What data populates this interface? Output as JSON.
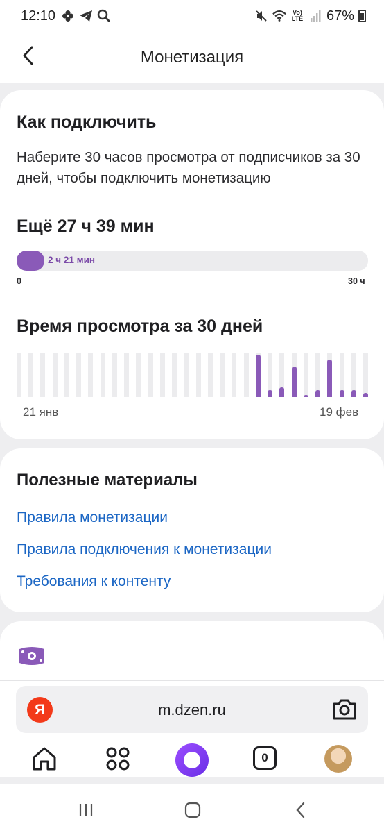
{
  "status_bar": {
    "time": "12:10",
    "battery_percent": "67%",
    "lte_label": "Vo) LTE"
  },
  "header": {
    "title": "Монетизация",
    "back_icon": "chevron-left-icon"
  },
  "how_to": {
    "title": "Как подключить",
    "description": "Наберите 30 часов просмотра от подписчиков за 30 дней, чтобы подключить монетизацию",
    "remaining": "Ещё 27 ч 39 мин",
    "progress_label": "2 ч 21 мин",
    "progress_fraction": 0.078,
    "axis_min": "0",
    "axis_max": "30 ч"
  },
  "watch_time": {
    "title": "Время просмотра за 30 дней",
    "start_label": "21 янв",
    "end_label": "19 фев",
    "accent_color": "#8a5ab8"
  },
  "chart_data": {
    "type": "bar",
    "values": [
      0,
      0,
      0,
      0,
      0,
      0,
      0,
      0,
      0,
      0,
      0,
      0,
      0,
      0,
      0,
      0,
      0,
      0,
      0,
      0,
      0.95,
      0.15,
      0.22,
      0.68,
      0.03,
      0.15,
      0.85,
      0.15,
      0.15,
      0.1
    ],
    "x_start": "21 янв",
    "x_end": "19 фев"
  },
  "materials": {
    "title": "Полезные материалы",
    "links": [
      "Правила монетизации",
      "Правила подключения к монетизации",
      "Требования к контенту"
    ]
  },
  "browser": {
    "url": "m.dzen.ru",
    "ya_letter": "Я",
    "tabs_count": "0"
  }
}
